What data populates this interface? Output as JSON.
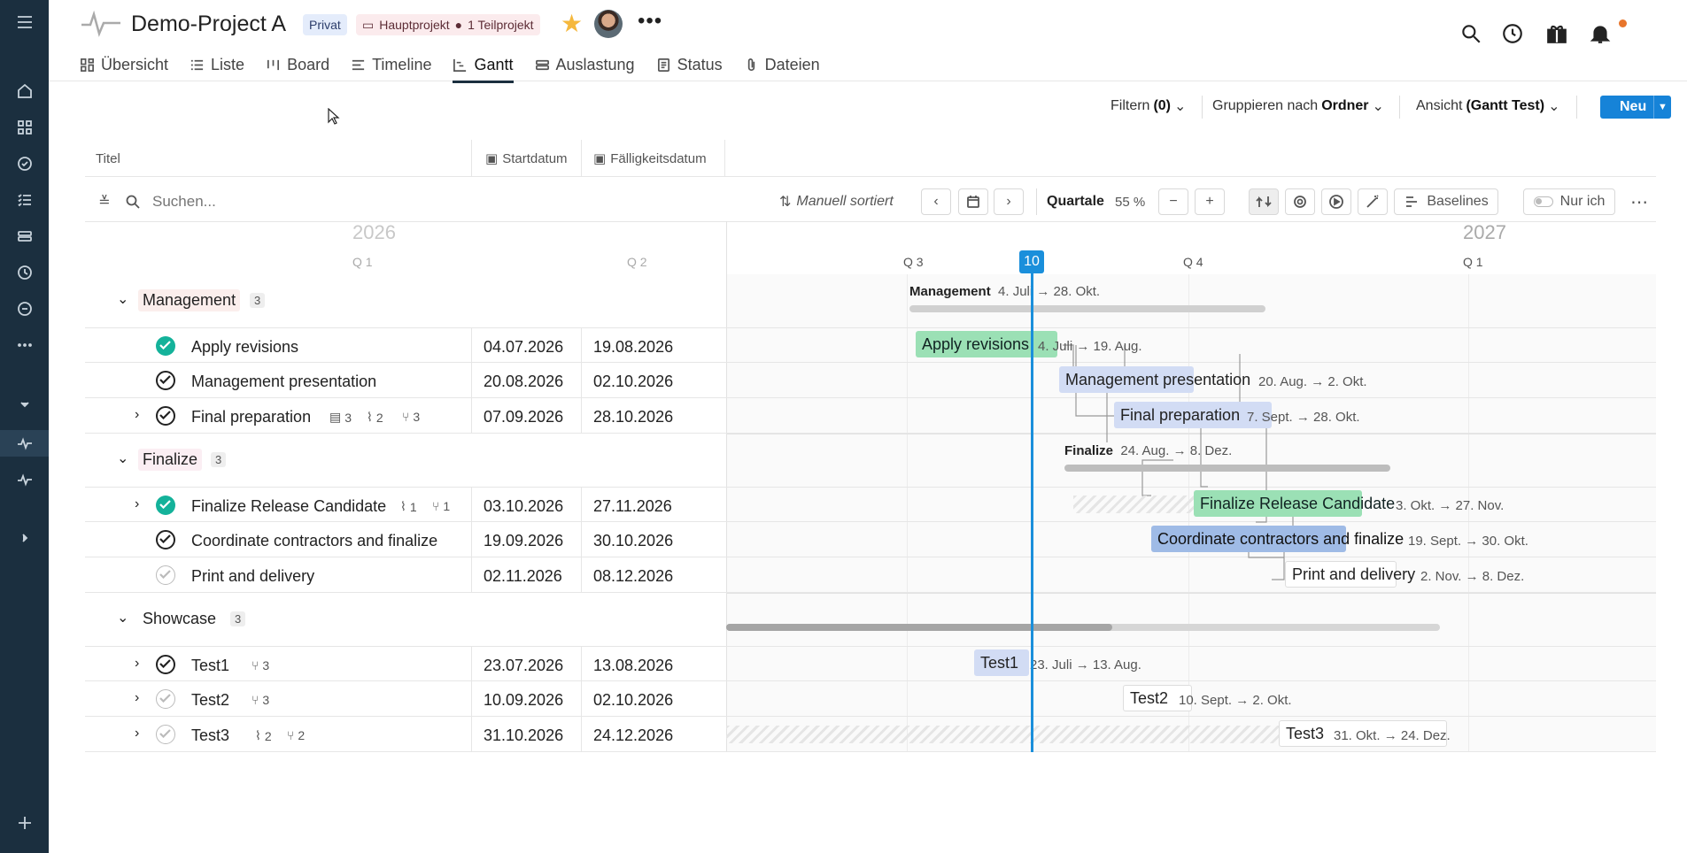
{
  "project": {
    "title": "Demo-Project A",
    "badge_private": "Privat",
    "badge_main": "Hauptprojekt",
    "badge_sub": "1 Teilprojekt"
  },
  "tabs": [
    {
      "label": "Übersicht",
      "icon": "grid-icon"
    },
    {
      "label": "Liste",
      "icon": "list-icon"
    },
    {
      "label": "Board",
      "icon": "board-icon"
    },
    {
      "label": "Timeline",
      "icon": "timeline-icon"
    },
    {
      "label": "Gantt",
      "icon": "gantt-icon",
      "active": true
    },
    {
      "label": "Auslastung",
      "icon": "workload-icon"
    },
    {
      "label": "Status",
      "icon": "status-icon"
    },
    {
      "label": "Dateien",
      "icon": "paperclip-icon"
    }
  ],
  "toolbar": {
    "filter_label": "Filtern",
    "filter_count": "(0)",
    "group_label": "Gruppieren nach",
    "group_value": "Ordner",
    "view_label": "Ansicht",
    "view_value": "(Gantt Test)",
    "new_label": "Neu"
  },
  "columns": {
    "title": "Titel",
    "start": "Startdatum",
    "due": "Fälligkeitsdatum"
  },
  "controls": {
    "search_placeholder": "Suchen...",
    "sort_label": "Manuell sortiert",
    "scale_label": "Quartale",
    "zoom": "55 %",
    "baselines_label": "Baselines",
    "only_me_label": "Nur ich"
  },
  "timeline": {
    "year_left": "2026",
    "year_right": "2027",
    "quarters": [
      "Q 1",
      "Q 2",
      "Q 3",
      "Q 4",
      "Q 1"
    ],
    "today": "10"
  },
  "groups": [
    {
      "name": "Management",
      "count": "3",
      "range": "4. Juli → 28. Okt.",
      "tasks": [
        {
          "title": "Apply revisions",
          "start": "04.07.2026",
          "due": "19.08.2026",
          "status": "done",
          "range": "4. Juli → 19. Aug."
        },
        {
          "title": "Management presentation",
          "start": "20.08.2026",
          "due": "02.10.2026",
          "status": "progress",
          "range": "20. Aug. → 2. Okt."
        },
        {
          "title": "Final preparation",
          "start": "07.09.2026",
          "due": "28.10.2026",
          "status": "progress",
          "range": "7. Sept. → 28. Okt.",
          "comments": "3",
          "attachments": "2",
          "subtasks": "3"
        }
      ]
    },
    {
      "name": "Finalize",
      "count": "3",
      "range": "24. Aug. → 8. Dez.",
      "tasks": [
        {
          "title": "Finalize Release Candidate",
          "start": "03.10.2026",
          "due": "27.11.2026",
          "status": "done",
          "range": "3. Okt. → 27. Nov.",
          "attachments": "1",
          "subtasks": "1"
        },
        {
          "title": "Coordinate contractors and finalize",
          "start": "19.09.2026",
          "due": "30.10.2026",
          "status": "progress",
          "range": "19. Sept. → 30. Okt."
        },
        {
          "title": "Print and delivery",
          "start": "02.11.2026",
          "due": "08.12.2026",
          "status": "open",
          "range": "2. Nov. → 8. Dez."
        }
      ]
    },
    {
      "name": "Showcase",
      "count": "3",
      "tasks": [
        {
          "title": "Test1",
          "start": "23.07.2026",
          "due": "13.08.2026",
          "status": "progress",
          "range": "23. Juli → 13. Aug.",
          "subtasks": "3"
        },
        {
          "title": "Test2",
          "start": "10.09.2026",
          "due": "02.10.2026",
          "status": "open",
          "range": "10. Sept. → 2. Okt.",
          "subtasks": "3"
        },
        {
          "title": "Test3",
          "start": "31.10.2026",
          "due": "24.12.2026",
          "status": "open",
          "range": "31. Okt. → 24. Dez.",
          "attachments": "2",
          "subtasks": "2"
        }
      ]
    }
  ],
  "colors": {
    "sidebar": "#1b2f3f",
    "accent": "#1683d8",
    "today": "#1a8fdb",
    "done": "#14b29a",
    "bar_green": "#9be0b5",
    "bar_blue": "#d2dcf4",
    "star": "#f5b83d"
  }
}
